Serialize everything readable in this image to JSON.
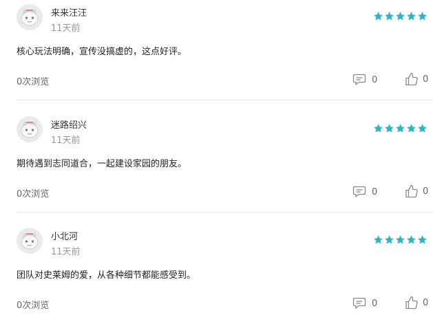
{
  "colors": {
    "star": "#2bb6c6",
    "icon": "#888888",
    "text_secondary": "#999999"
  },
  "icons": {
    "avatar": "cat-avatar-icon",
    "star": "star-icon",
    "comment": "comment-icon",
    "like": "thumbs-up-icon"
  },
  "reviews": [
    {
      "username": "来来汪汪",
      "time": "11天前",
      "rating": 5,
      "content": "核心玩法明确，宣传没搞虚的，这点好评。",
      "views": "0次浏览",
      "comments": "0",
      "likes": "0"
    },
    {
      "username": "迷路绍兴",
      "time": "11天前",
      "rating": 5,
      "content": "期待遇到志同道合，一起建设家园的朋友。",
      "views": "0次浏览",
      "comments": "0",
      "likes": "0"
    },
    {
      "username": "小北河",
      "time": "11天前",
      "rating": 5,
      "content": "团队对史莱姆的爱，从各种细节都能感受到。",
      "views": "0次浏览",
      "comments": "0",
      "likes": "0"
    }
  ]
}
